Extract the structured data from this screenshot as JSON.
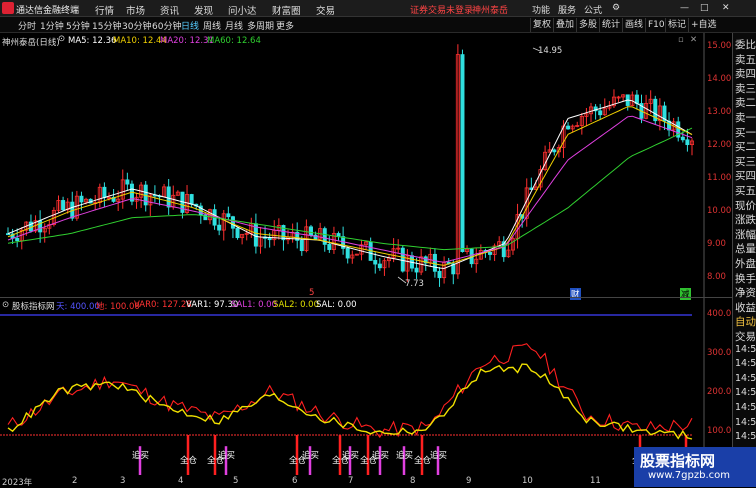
{
  "app": {
    "title": "通达信金融终端"
  },
  "menu": [
    "行情",
    "市场",
    "资讯",
    "发现",
    "问小达",
    "财富圈",
    "交易"
  ],
  "account": {
    "status": "证券交易未登录",
    "stock": "神州泰岳"
  },
  "window_controls": [
    "功能",
    "服务",
    "公式"
  ],
  "toolbar": {
    "timeframes": [
      "分时",
      "1分钟",
      "5分钟",
      "15分钟",
      "30分钟",
      "60分钟",
      "日线",
      "周线",
      "月线",
      "多周期",
      "更多"
    ],
    "active": "日线",
    "right_buttons": [
      "复权",
      "叠加",
      "多股",
      "统计",
      "画线",
      "F10",
      "标记",
      "+自选"
    ]
  },
  "main_legend": {
    "stock": "神州泰岳(日线)",
    "ma": [
      {
        "label": "MA5: 12.36",
        "color": "#ffffff"
      },
      {
        "label": "MA10: 12.44",
        "color": "#f0d000"
      },
      {
        "label": "MA20: 12.31",
        "color": "#e040e0"
      },
      {
        "label": "MA60: 12.64",
        "color": "#30d030"
      }
    ]
  },
  "main_axis": [
    "15.00",
    "14.00",
    "13.00",
    "12.00",
    "11.00",
    "10.00",
    "9.00",
    "8.00"
  ],
  "annotations": {
    "high": "14.95",
    "low": "7.73",
    "marker1": "5",
    "marker2": "财",
    "marker3": "减"
  },
  "sub_legend": {
    "name": "股标指标网",
    "items": [
      {
        "label": "天: 400.00",
        "color": "#5555ff"
      },
      {
        "label": "地: 100.00",
        "color": "#ff3333"
      },
      {
        "label": "VAR0: 127.28",
        "color": "#ff3333"
      },
      {
        "label": "VAR1: 97.30",
        "color": "#ffffff"
      },
      {
        "label": "SAL1: 0.00",
        "color": "#e040e0"
      },
      {
        "label": "SAL2: 0.00",
        "color": "#e0e000"
      },
      {
        "label": "SAL: 0.00",
        "color": "#ffffff"
      }
    ]
  },
  "sub_axis": [
    "400.0",
    "300.0",
    "200.0",
    "100.0"
  ],
  "signals": {
    "buy": "追买",
    "full": "全仓"
  },
  "dates": [
    "2023年",
    "2",
    "3",
    "4",
    "5",
    "6",
    "7",
    "8",
    "9",
    "10",
    "11",
    "12"
  ],
  "right_panel": [
    "委比",
    "卖五",
    "卖四",
    "卖三",
    "卖二",
    "卖一",
    "买一",
    "买二",
    "买三",
    "买四",
    "买五",
    "现价",
    "涨跌",
    "涨幅",
    "总量",
    "外盘",
    "换手",
    "净资",
    "收益",
    "自动",
    "交易",
    "14:5",
    "14:5",
    "14:5",
    "14:5",
    "14:5",
    "14:5",
    "14:5",
    "14:5",
    "14:5"
  ],
  "watermark": {
    "line1": "股票指标网",
    "line2": "www.7gpzb.com"
  },
  "chart_data": {
    "type": "line",
    "title": "",
    "ylim": [
      7.6,
      15.2
    ],
    "x": [
      "2023年",
      "2",
      "3",
      "4",
      "5",
      "6",
      "7",
      "8",
      "9",
      "10",
      "11",
      "12"
    ],
    "series": [
      {
        "name": "MA5",
        "values": [
          9.3,
          10.1,
          10.7,
          10.2,
          9.2,
          9.1,
          8.6,
          8.2,
          9.0,
          12.9,
          13.5,
          12.4
        ]
      },
      {
        "name": "MA10",
        "values": [
          9.2,
          10.0,
          10.6,
          10.1,
          9.3,
          9.1,
          8.7,
          8.3,
          8.9,
          12.4,
          13.3,
          12.4
        ]
      },
      {
        "name": "MA20",
        "values": [
          9.1,
          9.8,
          10.4,
          10.0,
          9.5,
          9.2,
          8.8,
          8.4,
          8.9,
          11.6,
          13.0,
          12.3
        ]
      },
      {
        "name": "MA60",
        "values": [
          9.0,
          9.3,
          9.8,
          9.9,
          9.6,
          9.3,
          9.0,
          8.8,
          8.9,
          10.1,
          11.7,
          12.6
        ]
      }
    ]
  },
  "oscillator_data": {
    "ylim": [
      0,
      420
    ],
    "series": [
      {
        "name": "VAR0",
        "values": [
          120,
          200,
          240,
          180,
          140,
          210,
          150,
          110,
          120,
          280,
          320,
          150,
          115,
          127
        ]
      },
      {
        "name": "VAR1",
        "values": [
          110,
          210,
          230,
          170,
          135,
          200,
          140,
          105,
          115,
          260,
          270,
          140,
          110,
          97
        ]
      }
    ]
  }
}
